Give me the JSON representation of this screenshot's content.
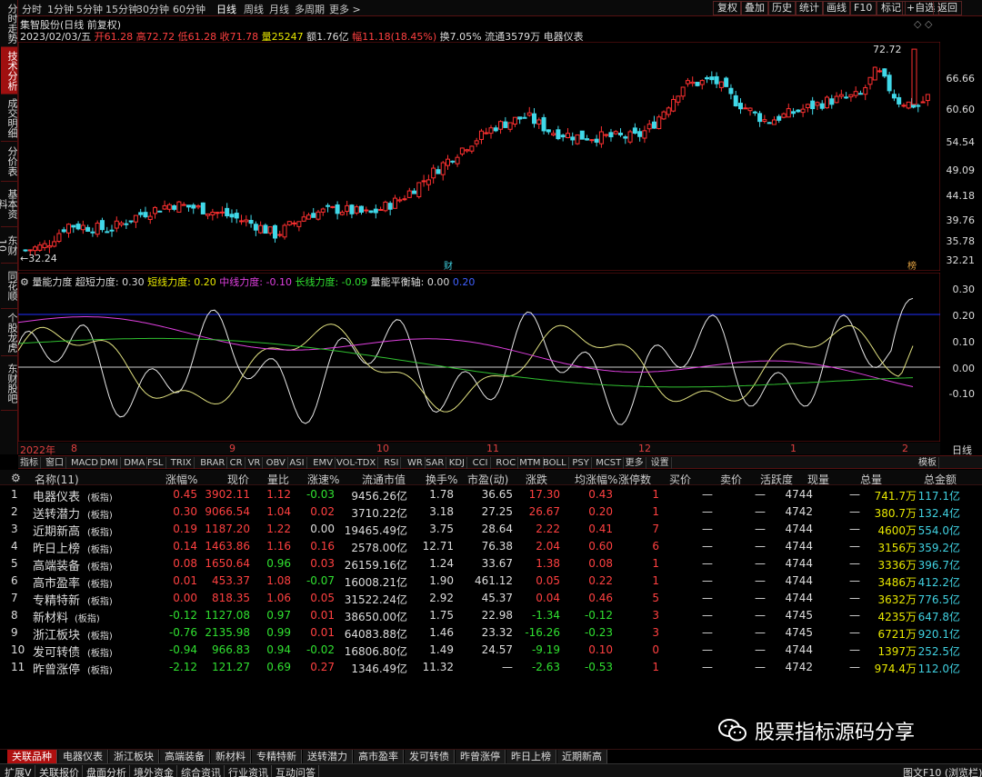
{
  "leftnav": [
    "分时走势",
    "技术分析",
    "成交明细",
    "分价表",
    "基本资料",
    "东财10",
    "同花顺",
    "个股龙虎",
    "东财股吧"
  ],
  "toolbar": {
    "periods": [
      "分时",
      "1分钟",
      "5分钟",
      "15分钟",
      "30分钟",
      "60分钟",
      "日线",
      "周线",
      "月线",
      "多周期",
      "更多 >"
    ],
    "right": [
      "复权",
      "叠加",
      "历史",
      "统计",
      "画线",
      "F10",
      "标记",
      "+自选",
      "返回"
    ]
  },
  "title": "集智股份(日线 前复权)",
  "info": {
    "date": "2023/02/03/五",
    "open": "开61.28",
    "high": "高72.72",
    "low": "低61.28",
    "close": "收71.78",
    "vol": "量25247",
    "amount": "额1.76亿",
    "change": "幅11.18(18.45%)",
    "turnover": "换7.05%",
    "float": "流通3579万",
    "sector": "电器仪表"
  },
  "price_axis": [
    "66.66",
    "60.60",
    "54.54",
    "49.09",
    "44.18",
    "39.76",
    "35.78",
    "32.21"
  ],
  "markers": {
    "high": "72.72",
    "low": "32.24",
    "cai": "财",
    "bang": "榜"
  },
  "indicator": {
    "name": "量能力度",
    "super": "超短力度: 0.30",
    "short": "短线力度: 0.20",
    "mid": "中线力度: -0.10",
    "long": "长线力度: -0.09",
    "balance": "量能平衡轴: 0.00",
    "extra": "0.20",
    "axis": [
      "0.30",
      "0.20",
      "0.10",
      "0.00",
      "-0.10"
    ]
  },
  "months": {
    "year": "2022年",
    "labels": [
      "8",
      "9",
      "10",
      "11",
      "12",
      "1",
      "2"
    ]
  },
  "daily_label": "日线",
  "ind_buttons": [
    "指标",
    "窗口",
    "MACD",
    "DMI",
    "DMA",
    "FSL",
    "TRIX",
    "BRAR",
    "CR",
    "VR",
    "OBV",
    "ASI",
    "EMV",
    "VOL-TDX",
    "RSI",
    "WR",
    "SAR",
    "KDJ",
    "CCI",
    "ROC",
    "MTM",
    "BOLL",
    "PSY",
    "MCST",
    "更多",
    "设置"
  ],
  "template_btn": "模板",
  "table": {
    "headers": [
      "名称(11)",
      "涨幅%",
      "现价",
      "量比",
      "涨速%",
      "流通市值",
      "换手%",
      "市盈(动)",
      "涨跌",
      "均涨幅%",
      "涨停数",
      "买价",
      "卖价",
      "活跃度",
      "现量",
      "总量",
      "总金额"
    ],
    "rows": [
      {
        "n": "1",
        "name": "电器仪表",
        "tag": "(板指)",
        "chg": "0.45",
        "price": "3902.11",
        "lb": "1.12",
        "sp": "-0.03",
        "mv": "9456.26亿",
        "to": "1.78",
        "pe": "36.65",
        "zd": "17.30",
        "avg": "0.43",
        "zt": "1",
        "buy": "—",
        "sell": "—",
        "act": "4744",
        "xl": "—",
        "vol": "741.7万",
        "amt": "117.1亿",
        "dir": "up"
      },
      {
        "n": "2",
        "name": "送转潜力",
        "tag": "(板指)",
        "chg": "0.30",
        "price": "9066.54",
        "lb": "1.04",
        "sp": "0.02",
        "mv": "3710.22亿",
        "to": "3.18",
        "pe": "27.25",
        "zd": "26.67",
        "avg": "0.20",
        "zt": "1",
        "buy": "—",
        "sell": "—",
        "act": "4742",
        "xl": "—",
        "vol": "380.7万",
        "amt": "132.4亿",
        "dir": "up"
      },
      {
        "n": "3",
        "name": "近期新高",
        "tag": "(板指)",
        "chg": "0.19",
        "price": "1187.20",
        "lb": "1.22",
        "sp": "0.00",
        "mv": "19465.49亿",
        "to": "3.75",
        "pe": "28.64",
        "zd": "2.22",
        "avg": "0.41",
        "zt": "7",
        "buy": "—",
        "sell": "—",
        "act": "4744",
        "xl": "—",
        "vol": "4600万",
        "amt": "554.0亿",
        "dir": "up"
      },
      {
        "n": "4",
        "name": "昨日上榜",
        "tag": "(板指)",
        "chg": "0.14",
        "price": "1463.86",
        "lb": "1.16",
        "sp": "0.16",
        "mv": "2578.00亿",
        "to": "12.71",
        "pe": "76.38",
        "zd": "2.04",
        "avg": "0.60",
        "zt": "6",
        "buy": "—",
        "sell": "—",
        "act": "4744",
        "xl": "—",
        "vol": "3156万",
        "amt": "359.2亿",
        "dir": "up"
      },
      {
        "n": "5",
        "name": "高端装备",
        "tag": "(板指)",
        "chg": "0.08",
        "price": "1650.64",
        "lb": "0.96",
        "sp": "0.03",
        "mv": "26159.16亿",
        "to": "1.24",
        "pe": "33.67",
        "zd": "1.38",
        "avg": "0.08",
        "zt": "1",
        "buy": "—",
        "sell": "—",
        "act": "4744",
        "xl": "—",
        "vol": "3336万",
        "amt": "396.7亿",
        "dir": "up"
      },
      {
        "n": "6",
        "name": "高市盈率",
        "tag": "(板指)",
        "chg": "0.01",
        "price": "453.37",
        "lb": "1.08",
        "sp": "-0.07",
        "mv": "16008.21亿",
        "to": "1.90",
        "pe": "461.12",
        "zd": "0.05",
        "avg": "0.22",
        "zt": "1",
        "buy": "—",
        "sell": "—",
        "act": "4744",
        "xl": "—",
        "vol": "3486万",
        "amt": "412.2亿",
        "dir": "up"
      },
      {
        "n": "7",
        "name": "专精特新",
        "tag": "(板指)",
        "chg": "0.00",
        "price": "818.35",
        "lb": "1.06",
        "sp": "0.05",
        "mv": "31522.24亿",
        "to": "2.92",
        "pe": "45.37",
        "zd": "0.04",
        "avg": "0.46",
        "zt": "5",
        "buy": "—",
        "sell": "—",
        "act": "4744",
        "xl": "—",
        "vol": "3632万",
        "amt": "776.5亿",
        "dir": "up"
      },
      {
        "n": "8",
        "name": "新材料",
        "tag": "(板指)",
        "chg": "-0.12",
        "price": "1127.08",
        "lb": "0.97",
        "sp": "0.01",
        "mv": "38650.00亿",
        "to": "1.75",
        "pe": "22.98",
        "zd": "-1.34",
        "avg": "-0.12",
        "zt": "3",
        "buy": "—",
        "sell": "—",
        "act": "4745",
        "xl": "—",
        "vol": "4235万",
        "amt": "647.8亿",
        "dir": "down"
      },
      {
        "n": "9",
        "name": "浙江板块",
        "tag": "(板指)",
        "chg": "-0.76",
        "price": "2135.98",
        "lb": "0.99",
        "sp": "0.01",
        "mv": "64083.88亿",
        "to": "1.46",
        "pe": "23.32",
        "zd": "-16.26",
        "avg": "-0.23",
        "zt": "3",
        "buy": "—",
        "sell": "—",
        "act": "4745",
        "xl": "—",
        "vol": "6721万",
        "amt": "920.1亿",
        "dir": "down"
      },
      {
        "n": "10",
        "name": "发可转债",
        "tag": "(板指)",
        "chg": "-0.94",
        "price": "966.83",
        "lb": "0.94",
        "sp": "-0.02",
        "mv": "16806.80亿",
        "to": "1.49",
        "pe": "24.57",
        "zd": "-9.19",
        "avg": "0.10",
        "zt": "0",
        "buy": "—",
        "sell": "—",
        "act": "4744",
        "xl": "—",
        "vol": "1397万",
        "amt": "252.5亿",
        "dir": "down"
      },
      {
        "n": "11",
        "name": "昨曾涨停",
        "tag": "(板指)",
        "chg": "-2.12",
        "price": "121.27",
        "lb": "0.69",
        "sp": "0.27",
        "mv": "1346.49亿",
        "to": "11.32",
        "pe": "—",
        "zd": "-2.63",
        "avg": "-0.53",
        "zt": "1",
        "buy": "—",
        "sell": "—",
        "act": "4742",
        "xl": "—",
        "vol": "974.4万",
        "amt": "112.0亿",
        "dir": "down"
      }
    ]
  },
  "bottom_tabs": [
    "关联品种",
    "电器仪表",
    "浙江板块",
    "高端装备",
    "新材料",
    "专精特新",
    "送转潜力",
    "高市盈率",
    "发可转债",
    "昨曾涨停",
    "昨日上榜",
    "近期新高"
  ],
  "status": [
    "扩展V",
    "关联报价",
    "盘面分析",
    "境外资金",
    "综合资讯",
    "行业资讯",
    "互动问答"
  ],
  "status_right": "图文F10 (浏览栏)»",
  "watermark": "股票指标源码分享"
}
